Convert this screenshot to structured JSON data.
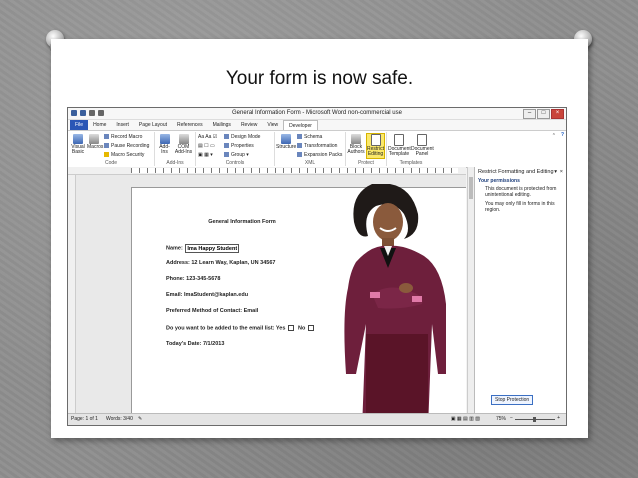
{
  "slide": {
    "title": "Your form is now safe."
  },
  "window": {
    "title": "General Information Form - Microsoft Word non-commercial use"
  },
  "tabs": [
    {
      "label": "File"
    },
    {
      "label": "Home"
    },
    {
      "label": "Insert"
    },
    {
      "label": "Page Layout"
    },
    {
      "label": "References"
    },
    {
      "label": "Mailings"
    },
    {
      "label": "Review"
    },
    {
      "label": "View"
    },
    {
      "label": "Developer"
    }
  ],
  "ribbon": {
    "code": {
      "label": "Code",
      "visual_basic": "Visual Basic",
      "macros": "Macros",
      "record_macro": "Record Macro",
      "pause_recording": "Pause Recording",
      "macro_security": "Macro Security"
    },
    "addins": {
      "label": "Add-Ins",
      "addins": "Add-Ins",
      "com_addins": "COM Add-Ins"
    },
    "controls": {
      "label": "Controls",
      "design_mode": "Design Mode",
      "properties": "Properties",
      "group": "Group"
    },
    "xml": {
      "label": "XML",
      "structure": "Structure",
      "schema": "Schema",
      "transformation": "Transformation",
      "expansion_packs": "Expansion Packs"
    },
    "protect": {
      "label": "Protect",
      "block_authors": "Block Authors",
      "restrict_editing": "Restrict Editing"
    },
    "templates": {
      "label": "Templates",
      "document_template": "Document Template",
      "document_panel": "Document Panel"
    }
  },
  "form": {
    "title": "General Information Form",
    "name_label": "Name:",
    "name_value": "Ima Happy Student",
    "address": "Address:  12 Learn Way, Kaplan, UN  34567",
    "phone": "Phone:  123-345-5678",
    "email": "Email:  ImaStudent@kaplan.edu",
    "preferred": "Preferred Method of Contact:  Email",
    "email_list_question": "Do you want to be added to the email list:  Yes",
    "no_label": "No",
    "date": "Today's Date:  7/1/2013"
  },
  "pane": {
    "title": "Restrict Formatting and Editing",
    "subtitle": "Your permissions",
    "text1": "This document is protected from unintentional editing.",
    "text2": "You may only fill in forms in this region.",
    "stop_button": "Stop Protection"
  },
  "status": {
    "page": "Page: 1 of 1",
    "words": "Words: 3/40",
    "zoom": "75%"
  },
  "colors": {
    "file_tab": "#2a56b6",
    "restrict_highlight": "#fbe96b"
  }
}
